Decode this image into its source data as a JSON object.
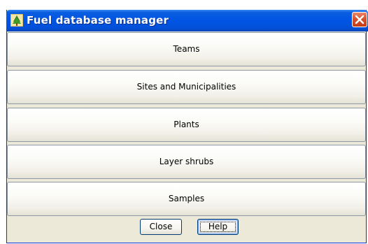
{
  "window": {
    "title": "Fuel database manager",
    "icon": "tree-icon",
    "close_icon": "close-icon"
  },
  "menu": {
    "buttons": [
      {
        "label": "Teams"
      },
      {
        "label": "Sites and Municipalities"
      },
      {
        "label": "Plants"
      },
      {
        "label": "Layer shrubs"
      },
      {
        "label": "Samples"
      }
    ]
  },
  "footer": {
    "close_label": "Close",
    "help_label": "Help"
  },
  "colors": {
    "titlebar": "#0054e3",
    "close_button": "#d6532d",
    "window_bg": "#ece9d8"
  }
}
